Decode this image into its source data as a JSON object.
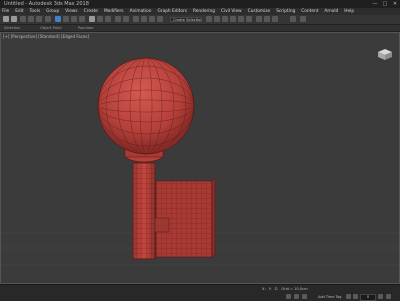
{
  "titlebar": {
    "title": "Untitled - Autodesk 3ds Max 2018",
    "min_glyph": "—",
    "max_glyph": "□",
    "close_glyph": "✕"
  },
  "menu": [
    "File",
    "Edit",
    "Tools",
    "Group",
    "Views",
    "Create",
    "Modifiers",
    "Animation",
    "Graph Editors",
    "Rendering",
    "Civil View",
    "Customize",
    "Scripting",
    "Content",
    "Arnold",
    "Help"
  ],
  "toolbar": {
    "selection_set_placeholder": "Create Selection Se",
    "buttons": [
      "undo-icon",
      "redo-icon",
      "link-icon",
      "unlink-icon",
      "bind-space-warp-icon",
      "selection-filter-icon",
      "select-object-icon",
      "select-by-name-icon",
      "rectangular-selection-icon",
      "window-crossing-icon",
      "select-and-move-icon",
      "select-and-rotate-icon",
      "select-and-scale-icon",
      "reference-coordinate-icon",
      "pivot-center-icon",
      "snap-toggle-icon",
      "angle-snap-icon",
      "percent-snap-icon",
      "mirror-icon",
      "align-icon"
    ]
  },
  "subtoolbar": {
    "left": "Selection",
    "middle": "Object Paint",
    "right": "Populate"
  },
  "viewport": {
    "label": "[+] [Perspective] [Standard] [Edged Faces]",
    "object_color": "#b3403a",
    "grid_color": "#4a4a4a",
    "background": "#3b3b3b"
  },
  "status": {
    "x_label": "X:",
    "x_value": "",
    "y_label": "Y:",
    "y_value": "",
    "z_label": "Z:",
    "z_value": "",
    "grid_label": "Grid = 10,0cm",
    "add_time_tag": "Add Time Tag",
    "frame_value": "0"
  }
}
